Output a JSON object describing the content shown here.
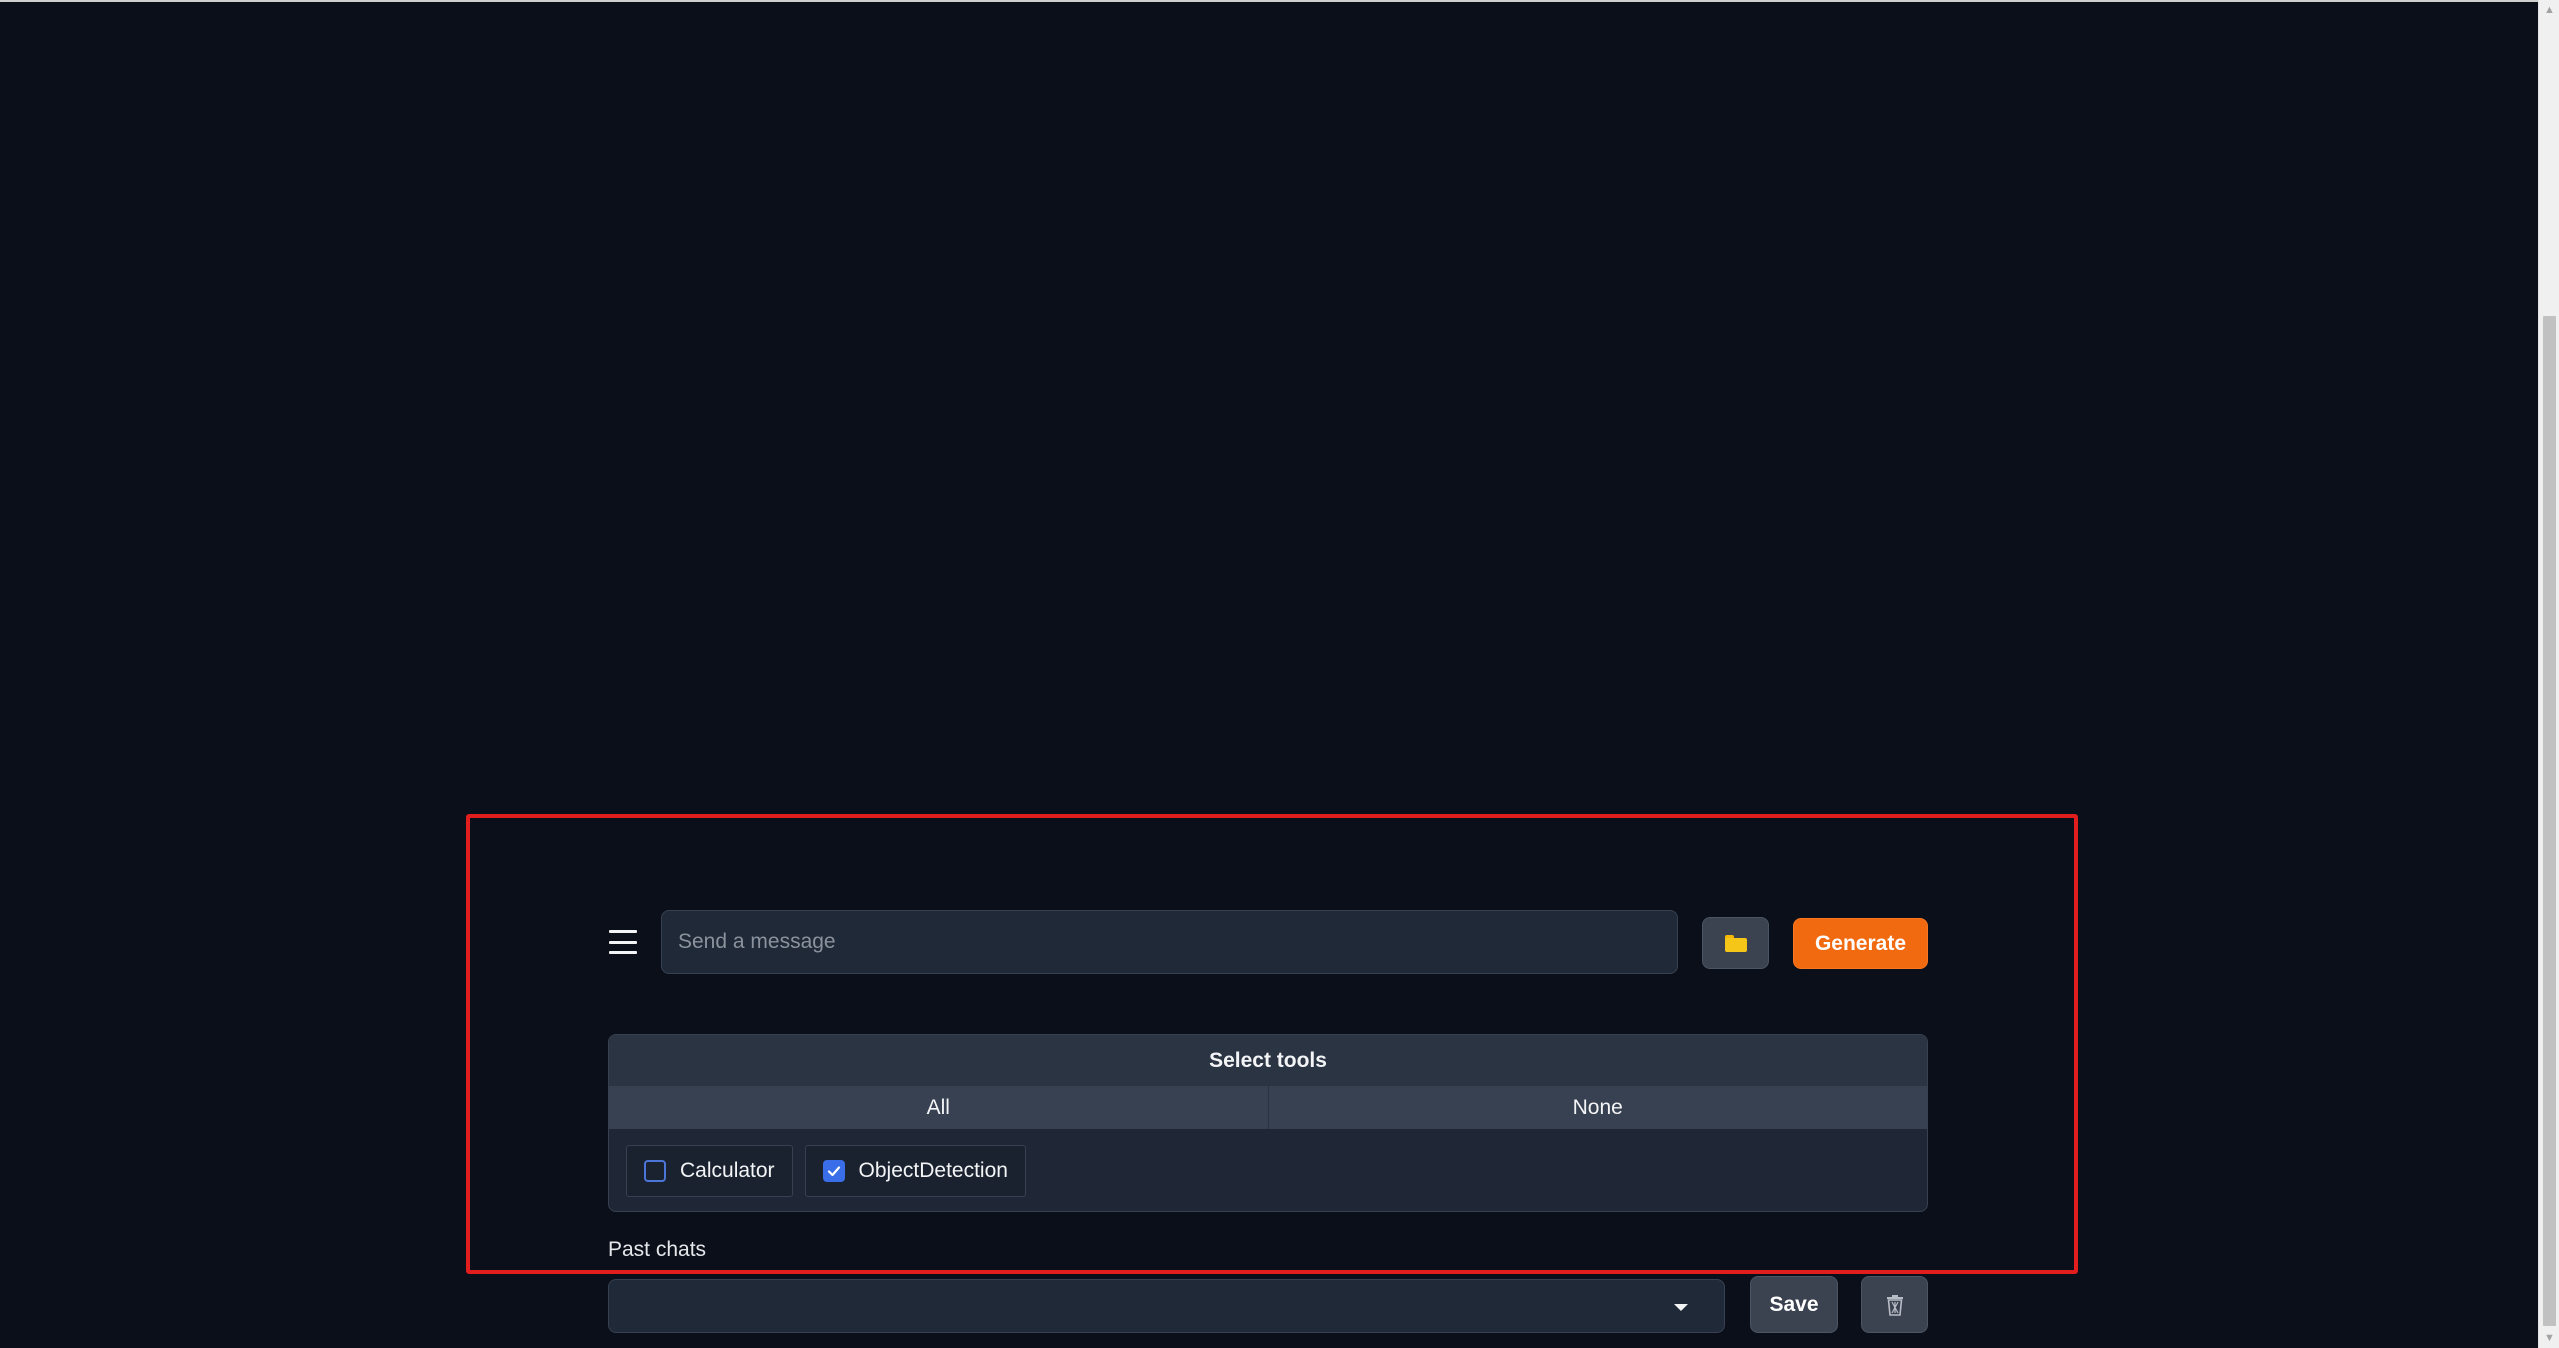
{
  "composer": {
    "placeholder": "Send a message",
    "generate_label": "Generate",
    "menu_icon": "hamburger-menu-icon",
    "upload_icon": "folder-icon"
  },
  "tools": {
    "title": "Select tools",
    "all_label": "All",
    "none_label": "None",
    "options": [
      {
        "label": "Calculator",
        "checked": false
      },
      {
        "label": "ObjectDetection",
        "checked": true
      }
    ]
  },
  "past_chats": {
    "label": "Past chats",
    "selected": "",
    "save_label": "Save",
    "delete_icon": "trash-icon"
  },
  "colors": {
    "background": "#0b0f19",
    "accent": "#f26a0f",
    "checkbox_checked": "#3a6ee8",
    "highlight": "#e11d1d"
  }
}
